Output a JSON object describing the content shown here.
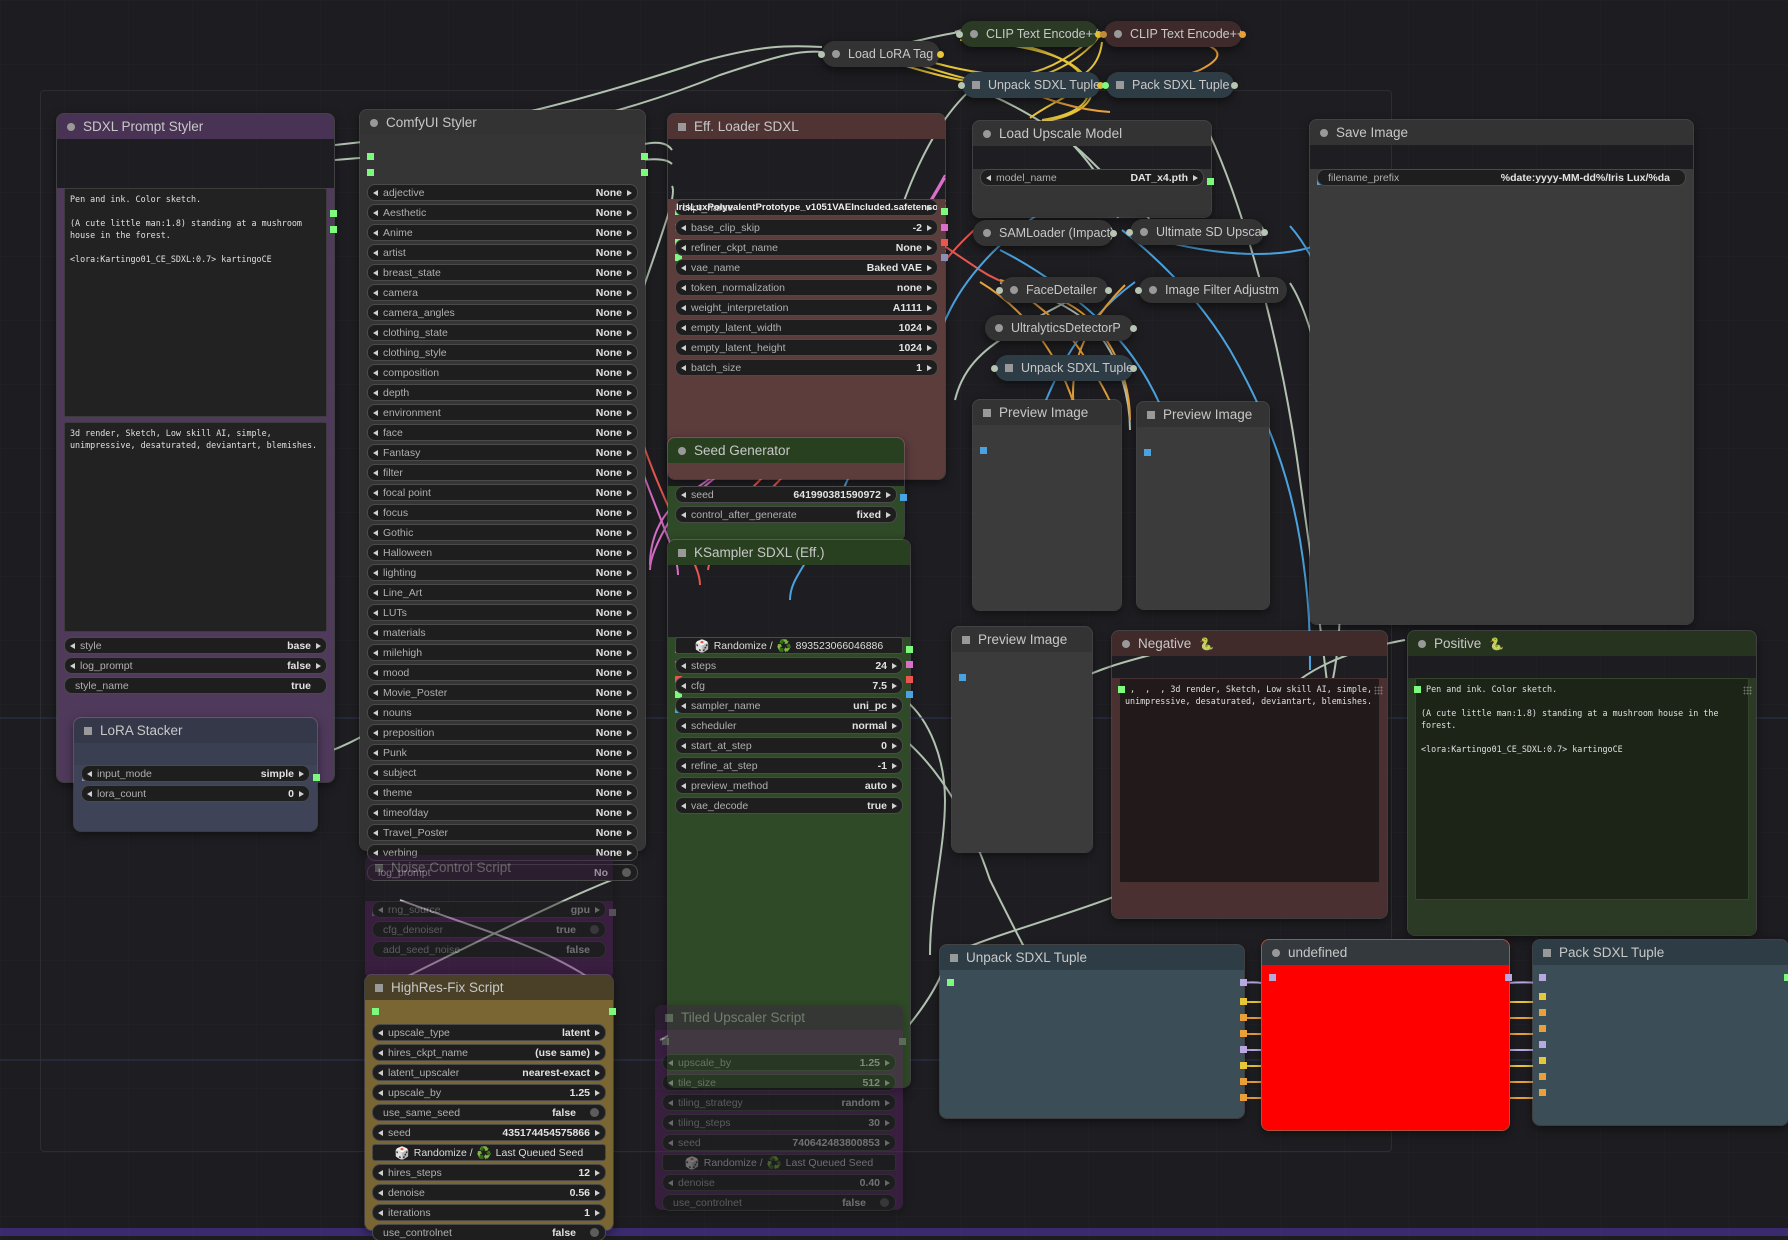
{
  "app": {
    "name": "ComfyUI",
    "canvas_bg": "#1d1d21",
    "accent_red": "#ff0000"
  },
  "nodes": {
    "sdxl_prompt_styler": {
      "title": "SDXL Prompt Styler",
      "positive_text": "Pen and ink. Color sketch.\n\n(A cute little man:1.8) standing at a mushroom house in the forest.\n\n<lora:Kartingo01_CE_SDXL:0.7> kartingoCE",
      "negative_text": "3d render, Sketch, Low skill AI, simple, unimpressive, desaturated, deviantart, blemishes.",
      "widgets": [
        {
          "label": "style",
          "value": "base",
          "type": "combo"
        },
        {
          "label": "log_prompt",
          "value": "false",
          "type": "combo"
        },
        {
          "label": "style_name",
          "value": "true",
          "type": "plain"
        }
      ]
    },
    "lora_stacker": {
      "title": "LoRA Stacker",
      "widgets": [
        {
          "label": "input_mode",
          "value": "simple",
          "type": "combo"
        },
        {
          "label": "lora_count",
          "value": "0",
          "type": "combo"
        }
      ]
    },
    "comfyui_styler": {
      "title": "ComfyUI Styler",
      "widgets": [
        {
          "label": "adjective",
          "value": "None",
          "type": "combo"
        },
        {
          "label": "Aesthetic",
          "value": "None",
          "type": "combo"
        },
        {
          "label": "Anime",
          "value": "None",
          "type": "combo"
        },
        {
          "label": "artist",
          "value": "None",
          "type": "combo"
        },
        {
          "label": "breast_state",
          "value": "None",
          "type": "combo"
        },
        {
          "label": "camera",
          "value": "None",
          "type": "combo"
        },
        {
          "label": "camera_angles",
          "value": "None",
          "type": "combo"
        },
        {
          "label": "clothing_state",
          "value": "None",
          "type": "combo"
        },
        {
          "label": "clothing_style",
          "value": "None",
          "type": "combo"
        },
        {
          "label": "composition",
          "value": "None",
          "type": "combo"
        },
        {
          "label": "depth",
          "value": "None",
          "type": "combo"
        },
        {
          "label": "environment",
          "value": "None",
          "type": "combo"
        },
        {
          "label": "face",
          "value": "None",
          "type": "combo"
        },
        {
          "label": "Fantasy",
          "value": "None",
          "type": "combo"
        },
        {
          "label": "filter",
          "value": "None",
          "type": "combo"
        },
        {
          "label": "focal point",
          "value": "None",
          "type": "combo"
        },
        {
          "label": "focus",
          "value": "None",
          "type": "combo"
        },
        {
          "label": "Gothic",
          "value": "None",
          "type": "combo"
        },
        {
          "label": "Halloween",
          "value": "None",
          "type": "combo"
        },
        {
          "label": "lighting",
          "value": "None",
          "type": "combo"
        },
        {
          "label": "Line_Art",
          "value": "None",
          "type": "combo"
        },
        {
          "label": "LUTs",
          "value": "None",
          "type": "combo"
        },
        {
          "label": "materials",
          "value": "None",
          "type": "combo"
        },
        {
          "label": "milehigh",
          "value": "None",
          "type": "combo"
        },
        {
          "label": "mood",
          "value": "None",
          "type": "combo"
        },
        {
          "label": "Movie_Poster",
          "value": "None",
          "type": "combo"
        },
        {
          "label": "nouns",
          "value": "None",
          "type": "combo"
        },
        {
          "label": "preposition",
          "value": "None",
          "type": "combo"
        },
        {
          "label": "Punk",
          "value": "None",
          "type": "combo"
        },
        {
          "label": "subject",
          "value": "None",
          "type": "combo"
        },
        {
          "label": "theme",
          "value": "None",
          "type": "combo"
        },
        {
          "label": "timeofday",
          "value": "None",
          "type": "combo"
        },
        {
          "label": "Travel_Poster",
          "value": "None",
          "type": "combo"
        },
        {
          "label": "verbing",
          "value": "None",
          "type": "combo"
        },
        {
          "label": "log_prompt",
          "value": "No",
          "type": "toggle"
        }
      ]
    },
    "eff_loader_sdxl": {
      "title": "Eff. Loader SDXL",
      "ckpt_overlap_label": "ckpt_name",
      "ckpt_value": "IrisLuxPolyvalentPrototype_v1051VAEIncluded.safetensors",
      "widgets": [
        {
          "label": "base_clip_skip",
          "value": "-2",
          "type": "combo"
        },
        {
          "label": "refiner_ckpt_name",
          "value": "None",
          "type": "combo"
        },
        {
          "label": "vae_name",
          "value": "Baked VAE",
          "type": "combo"
        },
        {
          "label": "token_normalization",
          "value": "none",
          "type": "combo"
        },
        {
          "label": "weight_interpretation",
          "value": "A1111",
          "type": "combo"
        },
        {
          "label": "empty_latent_width",
          "value": "1024",
          "type": "combo"
        },
        {
          "label": "empty_latent_height",
          "value": "1024",
          "type": "combo"
        },
        {
          "label": "batch_size",
          "value": "1",
          "type": "combo"
        }
      ]
    },
    "seed_generator": {
      "title": "Seed Generator",
      "widgets": [
        {
          "label": "seed",
          "value": "641990381590972",
          "type": "combo"
        },
        {
          "label": "control_after_generate",
          "value": "fixed",
          "type": "combo"
        }
      ]
    },
    "ksampler_sdxl": {
      "title": "KSampler SDXL (Eff.)",
      "seed_button": "Randomize /  893523066046886",
      "seed_button_prefix": "Randomize /",
      "seed_button_value": "893523066046886",
      "widgets": [
        {
          "label": "steps",
          "value": "24",
          "type": "combo"
        },
        {
          "label": "cfg",
          "value": "7.5",
          "type": "combo"
        },
        {
          "label": "sampler_name",
          "value": "uni_pc",
          "type": "combo"
        },
        {
          "label": "scheduler",
          "value": "normal",
          "type": "combo"
        },
        {
          "label": "start_at_step",
          "value": "0",
          "type": "combo"
        },
        {
          "label": "refine_at_step",
          "value": "-1",
          "type": "combo"
        },
        {
          "label": "preview_method",
          "value": "auto",
          "type": "combo"
        },
        {
          "label": "vae_decode",
          "value": "true",
          "type": "combo"
        }
      ]
    },
    "noise_control_script": {
      "title": "Noise Control Script",
      "widgets": [
        {
          "label": "rng_source",
          "value": "gpu",
          "type": "combo"
        },
        {
          "label": "cfg_denoiser",
          "value": "true",
          "type": "toggle"
        },
        {
          "label": "add_seed_noise",
          "value": "false",
          "type": "plain"
        }
      ]
    },
    "highres_fix_script": {
      "title": "HighRes-Fix Script",
      "seed_button_prefix": "Randomize /",
      "seed_button_value": "Last Queued Seed",
      "widgets": [
        {
          "label": "upscale_type",
          "value": "latent",
          "type": "combo"
        },
        {
          "label": "hires_ckpt_name",
          "value": "(use same)",
          "type": "combo"
        },
        {
          "label": "latent_upscaler",
          "value": "nearest-exact",
          "type": "combo"
        },
        {
          "label": "upscale_by",
          "value": "1.25",
          "type": "combo"
        },
        {
          "label": "use_same_seed",
          "value": "false",
          "type": "toggle"
        },
        {
          "label": "seed",
          "value": "435174454575866",
          "type": "combo"
        },
        {
          "label": "hires_steps",
          "value": "12",
          "type": "combo"
        },
        {
          "label": "denoise",
          "value": "0.56",
          "type": "combo"
        },
        {
          "label": "iterations",
          "value": "1",
          "type": "combo"
        },
        {
          "label": "use_controlnet",
          "value": "false",
          "type": "toggle"
        }
      ]
    },
    "tiled_upscaler_script": {
      "title": "Tiled Upscaler Script",
      "seed_button_prefix": "Randomize /",
      "seed_button_value": "Last Queued Seed",
      "widgets": [
        {
          "label": "upscale_by",
          "value": "1.25",
          "type": "combo"
        },
        {
          "label": "tile_size",
          "value": "512",
          "type": "combo"
        },
        {
          "label": "tiling_strategy",
          "value": "random",
          "type": "combo"
        },
        {
          "label": "tiling_steps",
          "value": "30",
          "type": "combo"
        },
        {
          "label": "seed",
          "value": "740642483800853",
          "type": "combo"
        },
        {
          "label": "denoise",
          "value": "0.40",
          "type": "combo"
        },
        {
          "label": "use_controlnet",
          "value": "false",
          "type": "toggle"
        }
      ]
    },
    "load_lora_tag": {
      "title": "Load LoRA Tag"
    },
    "clip_text_encode_pos": {
      "title": "CLIP Text Encode++"
    },
    "clip_text_encode_neg": {
      "title": "CLIP Text Encode++"
    },
    "unpack_sdxl_tuple_top": {
      "title": "Unpack SDXL Tuple"
    },
    "pack_sdxl_tuple_top": {
      "title": "Pack SDXL Tuple"
    },
    "load_upscale_model": {
      "title": "Load Upscale Model",
      "widgets": [
        {
          "label": "model_name",
          "value": "DAT_x4.pth",
          "type": "combo"
        }
      ]
    },
    "samloader_impact": {
      "title": "SAMLoader (Impact)"
    },
    "ultimate_sd_upscale": {
      "title": "Ultimate SD Upscale"
    },
    "facedetailer": {
      "title": "FaceDetailer"
    },
    "image_filter_adjust": {
      "title": "Image Filter Adjustm"
    },
    "ultralytics_detector": {
      "title": "UltralyticsDetectorP"
    },
    "unpack_sdxl_tuple_mid": {
      "title": "Unpack SDXL Tuple"
    },
    "preview_image_1": {
      "title": "Preview Image"
    },
    "preview_image_2": {
      "title": "Preview Image"
    },
    "preview_image_3": {
      "title": "Preview Image"
    },
    "save_image": {
      "title": "Save Image",
      "widgets": [
        {
          "label": "filename_prefix",
          "value": "%date:yyyy-MM-dd%/Iris Lux/%da",
          "type": "plain"
        }
      ]
    },
    "negative_prompt": {
      "title": "Negative",
      "emoji": "🐍",
      "text": " ,  ,  , 3d render, Sketch, Low skill AI, simple, unimpressive, desaturated, deviantart, blemishes."
    },
    "positive_prompt": {
      "title": "Positive",
      "emoji": "🐍",
      "text": " Pen and ink. Color sketch.\n\n(A cute little man:1.8) standing at a mushroom house in the forest.\n\n<lora:Kartingo01_CE_SDXL:0.7> kartingoCE"
    },
    "unpack_sdxl_tuple_bottom": {
      "title": "Unpack SDXL Tuple"
    },
    "undefined_node": {
      "title": "undefined"
    },
    "pack_sdxl_tuple_bottom": {
      "title": "Pack SDXL Tuple"
    }
  }
}
